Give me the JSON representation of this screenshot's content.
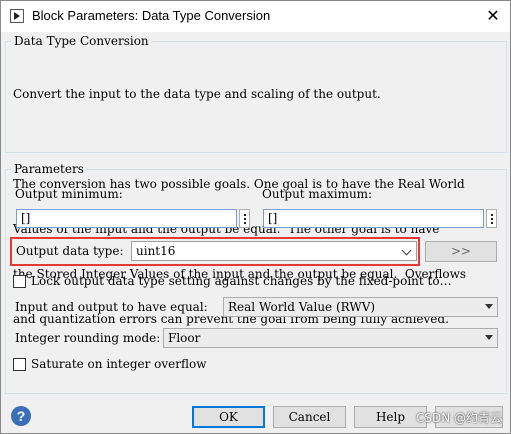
{
  "window": {
    "title": "Block Parameters: Data Type Conversion",
    "close_glyph": "✕"
  },
  "block_group": {
    "legend": "Data Type Conversion",
    "description": [
      "Convert the input to the data type and scaling of the output.",
      "",
      "The conversion has two possible goals. One goal is to have the Real World",
      "Values of the input and the output be equal.  The other goal is to have",
      "the Stored Integer Values of the input and the output be equal.  Overflows",
      "and quantization errors can prevent the goal from being fully achieved."
    ]
  },
  "parameters": {
    "legend": "Parameters",
    "output_minimum_label": "Output minimum:",
    "output_minimum_value": "[]",
    "output_maximum_label": "Output maximum:",
    "output_maximum_value": "[]",
    "output_data_type_label": "Output data type:",
    "output_data_type_value": "uint16",
    "assistant_button": ">>",
    "lock_label": "Lock output data type setting against changes by the fixed-point to…",
    "equal_label": "Input and output to have equal:",
    "equal_value": "Real World Value (RWV)",
    "rounding_label": "Integer rounding mode:",
    "rounding_value": "Floor",
    "saturate_label": "Saturate on integer overflow"
  },
  "buttons": {
    "ok": "OK",
    "cancel": "Cancel",
    "help": "Help",
    "help_icon": "?"
  },
  "watermark": "CSDN @约青云",
  "colors": {
    "highlight": "#e53935",
    "default_button_border": "#0078d7"
  }
}
